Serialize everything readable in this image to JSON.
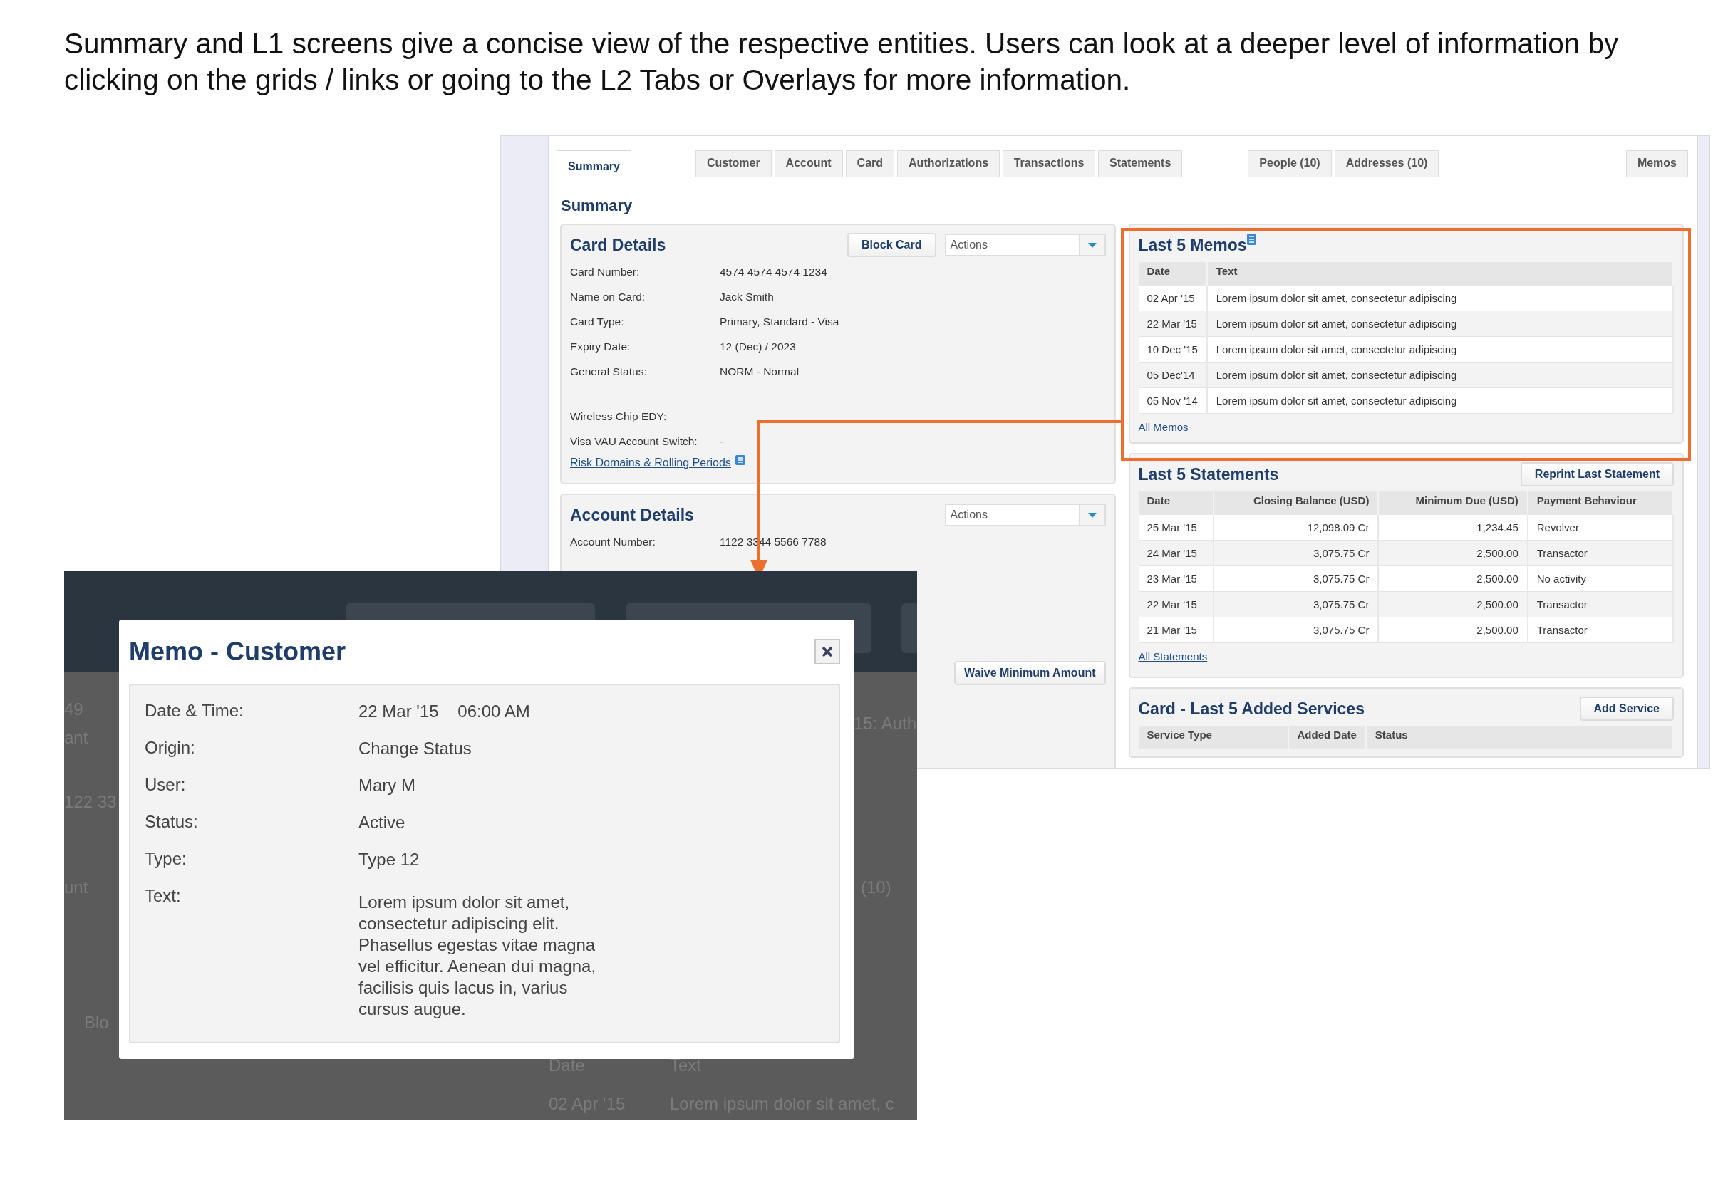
{
  "intro": "Summary and L1 screens give a concise view of the respective entities. Users can look at a deeper level of information by clicking on the grids / links or going to the L2 Tabs  or Overlays for more information.",
  "screen": {
    "tabs": [
      {
        "label": "Summary",
        "selected": true
      },
      {
        "label": "Customer",
        "selected": false
      },
      {
        "label": "Account",
        "selected": false
      },
      {
        "label": "Card",
        "selected": false
      },
      {
        "label": "Authorizations",
        "selected": false
      },
      {
        "label": "Transactions",
        "selected": false
      },
      {
        "label": "Statements",
        "selected": false
      },
      {
        "label": "People (10)",
        "selected": false
      },
      {
        "label": "Addresses (10)",
        "selected": false
      },
      {
        "label": "Memos",
        "selected": false
      }
    ],
    "heading": "Summary",
    "card_details": {
      "title": "Card Details",
      "button": "Block Card",
      "dropdown": "Actions",
      "fields": [
        {
          "label": "Card Number:",
          "value": "4574 4574 4574 1234"
        },
        {
          "label": "Name on Card:",
          "value": "Jack Smith"
        },
        {
          "label": "Card Type:",
          "value": "Primary, Standard - Visa"
        },
        {
          "label": "Expiry Date:",
          "value": "12 (Dec) / 2023"
        },
        {
          "label": "General Status:",
          "value": "NORM - Normal"
        }
      ],
      "extra_fields": [
        {
          "label": "Wireless Chip EDY:"
        },
        {
          "label": "Visa VAU Account Switch:",
          "value": "-"
        }
      ],
      "link": "Risk Domains & Rolling Periods"
    },
    "account_details": {
      "title": "Account Details",
      "dropdown": "Actions",
      "fields": [
        {
          "label": "Account Number:",
          "value": "1122 3344 5566 7788"
        }
      ],
      "button": "Waive Minimum  Amount"
    },
    "memos": {
      "title": "Last 5 Memos",
      "columns": [
        "Date",
        "Text"
      ],
      "rows": [
        [
          "02 Apr '15",
          "Lorem ipsum dolor sit amet, consectetur adipiscing"
        ],
        [
          "22 Mar '15",
          "Lorem ipsum dolor sit amet, consectetur adipiscing"
        ],
        [
          "10 Dec '15",
          "Lorem ipsum dolor sit amet, consectetur adipiscing"
        ],
        [
          "05 Dec'14",
          "Lorem ipsum dolor sit amet, consectetur adipiscing"
        ],
        [
          "05 Nov '14",
          "Lorem ipsum dolor sit amet, consectetur adipiscing"
        ]
      ],
      "link": "All Memos"
    },
    "statements": {
      "title": "Last 5 Statements",
      "button": "Reprint Last Statement",
      "columns": [
        "Date",
        "Closing Balance (USD)",
        "Minimum Due (USD)",
        "Payment Behaviour"
      ],
      "rows": [
        [
          "25 Mar '15",
          "12,098.09  Cr",
          "1,234.45",
          "Revolver"
        ],
        [
          "24 Mar '15",
          "3,075.75  Cr",
          "2,500.00",
          "Transactor"
        ],
        [
          "23 Mar '15",
          "3,075.75  Cr",
          "2,500.00",
          "No activity"
        ],
        [
          "22 Mar '15",
          "3,075.75  Cr",
          "2,500.00",
          "Transactor"
        ],
        [
          "21 Mar '15",
          "3,075.75  Cr",
          "2,500.00",
          "Transactor"
        ]
      ],
      "link": "All Statements"
    },
    "services": {
      "title": "Card - Last 5 Added Services",
      "button": "Add Service",
      "columns": [
        "Service Type",
        "Added Date",
        "Status"
      ]
    }
  },
  "overlay": {
    "background_texts": [
      "49",
      "ant",
      "122 33",
      "unt",
      "Blo",
      "15: Auth",
      "(10)",
      "Date",
      "Text",
      "02 Apr '15",
      "Lorem ipsum dolor sit amet, c"
    ],
    "modal": {
      "title": "Memo - Customer",
      "fields": [
        {
          "label": "Date & Time:",
          "value": "22 Mar '15    06:00 AM"
        },
        {
          "label": "Origin:",
          "value": "Change Status"
        },
        {
          "label": "User:",
          "value": "Mary M"
        },
        {
          "label": "Status:",
          "value": "Active"
        },
        {
          "label": "Type:",
          "value": "Type 12"
        },
        {
          "label": "Text:",
          "value": "Lorem ipsum dolor sit amet, consectetur adipiscing elit. Phasellus egestas vitae magna vel efficitur. Aenean dui magna, facilisis quis lacus in, varius cursus augue."
        }
      ]
    }
  }
}
